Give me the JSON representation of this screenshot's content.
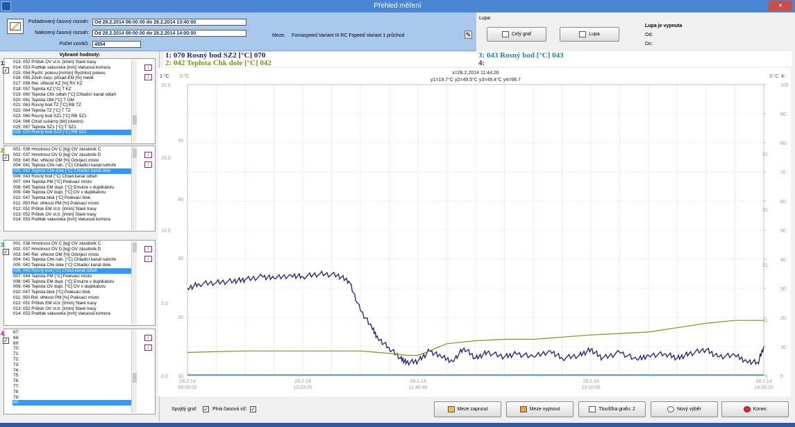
{
  "window": {
    "title": "Přehled měření",
    "close_label": "×"
  },
  "top": {
    "req_label": "Požadovaný časový rozsah:",
    "req_value": "Od 28.2.2014  08:00:00 do 28.2.2014  13:40:00",
    "found_label": "Nalezený časový rozsah:",
    "found_value": "Od 28.2.2014  08:00:00 do 28.2.2014  14:00:00",
    "count_label": "Počet vzorků:",
    "count_value": "4954",
    "limits_label": "Meze:",
    "limits_value": "Fomaspeed Variant III RC  Fspeed Variant 1 průchod"
  },
  "lupa": {
    "label": "Lupa:",
    "full_graph": "Celý graf",
    "zoom": "Lupa",
    "status": "Lupa je vypnuta",
    "od": "Od:",
    "do": "Do:"
  },
  "left": {
    "title": "Vybrané hodnoty:",
    "groups": [
      {
        "num": "1:",
        "items": [
          "013: 052 Průtok OV st.tr. [l/min]  Staré trasy",
          "014: 053 Podtlak vakuovka [mm]  Vakuová komora",
          "015: 054 Rychl. polevu [m/min]  Rychlost polevu",
          "016: 055 Zdvih čerp. přísad EM [%]  médii",
          "017: 056 Rel. vlhkost KZ [%]  RV KZ",
          "018: 057 Teplota KZ [°C]  T KZ",
          "019: 060 Teplota Chk odtah [°C]  Chladicí kanál odtah",
          "020: 061 Teplota OM [°C]  T OM",
          "021: 063 Rosný bod TZ [°C]  RB TZ",
          "022: 064 Teplota TZ [°C]  T TZ",
          "023: 065 Rosný bod SZ1 [°C]  RB SZ1",
          "024: 066 Chod sušárny [bit]  (vlastní)",
          "025: 067 Teplota SZ1 [°C]  T SZ1",
          "026: 070 Rosný bod SZ2 [°C]  RB SZ2"
        ],
        "selected": 13,
        "thumb": 0.78
      },
      {
        "num": "2:",
        "items": [
          "001: 036 Hmotnost OV C [kg]  OV zásobník C",
          "002: 037 Hmotnost OV D [kg]  OV zásobník D",
          "003: 040 Rel. vlhkost OM [%]  Odvíjecí místo",
          "004: 041 Teplota Chk nah. [°C]  Chladicí kanál nahoře",
          "005: 042 Teplota Chk dole [°C]  Chladicí kanál dole",
          "006: 043 Rosný bod [°C]  Chlad.kanál odtah",
          "007: 044 Teplota PM [°C]  Polévací místo",
          "008: 045 Teplota EM dupl. [°C]  Emulze v duplikátoru",
          "009: 046 Teplota OV dupl. [°C]  OV v duplikátoru",
          "010: 047 Teplota blok [°C]  Polévací blok",
          "011: 050 Rel. vlhkost PM [%]  Polévací místo",
          "012: 051 Průtok EM st.tr. [l/min]  Staré trasy",
          "013: 052 Průtok OV st.tr. [l/min]  Staré trasy",
          "014: 053 Podtlak vakuovka [mm]  Vakuová komora"
        ],
        "selected": 4,
        "thumb": 0.0
      },
      {
        "num": "3:",
        "items": [
          "001: 036 Hmotnost OV C [kg]  OV zásobník C",
          "002: 037 Hmotnost OV D [kg]  OV zásobník D",
          "003: 040 Rel. vlhkost OM [%]  Odvíjecí místo",
          "004: 041 Teplota Chk nah. [°C]  Chladicí kanál nahoře",
          "005: 042 Teplota Chk dole [°C]  Chladicí kanál dole",
          "006: 043 Rosný bod [°C]  Chlad.kanál odtah",
          "007: 044 Teplota PM [°C]  Polévací místo",
          "008: 045 Teplota EM dupl. [°C]  Emulze v duplikátoru",
          "009: 046 Teplota OV dupl. [°C]  OV v duplikátoru",
          "010: 047 Teplota blok [°C]  Polévací blok",
          "011: 050 Rel. vlhkost PM [%]  Polévací místo",
          "012: 051 Průtok EM st.tr. [l/min]  Staré trasy",
          "013: 052 Průtok OV st.tr. [l/min]  Staré trasy",
          "014: 053 Podtlak vakuovka [mm]  Vakuová komora"
        ],
        "selected": 5,
        "thumb": 0.0
      },
      {
        "num": "4:",
        "items": [
          "67:",
          "68:",
          "69:",
          "70:",
          "71:",
          "72:",
          "73:",
          "74:",
          "75:",
          "76:",
          "77:",
          "78:",
          "79:",
          "80:"
        ],
        "selected": 13,
        "thumb": 0.6
      }
    ]
  },
  "legend": {
    "l1": "1:  070 Rosný bod SZ2 [°C]  070",
    "l2": "2:  042 Teplota Chk dole [°C]  042",
    "l3": "3:  043 Rosný bod [°C]  043",
    "l4": "4:",
    "c1": "#1a1a7a",
    "c2": "#8a8a1a",
    "c3": "#1a8a8a",
    "c4": "#8a1a8a"
  },
  "chart_data": {
    "type": "line",
    "cursor_x": "x=28.2.2014  11:44:26",
    "cursor_y": "y1=19.7°C   y2=49.5°C   y3=49.4°C   y4=98.7",
    "axis_units": {
      "y1": "1:°C",
      "y2": "2:°C",
      "y3": "3:°C",
      "y4": "4:"
    },
    "x_ticks": [
      {
        "date": "28.2.14",
        "time": "09:00:00",
        "pos": 0.0
      },
      {
        "date": "28.2.14",
        "time": "10:23:20",
        "pos": 0.2
      },
      {
        "date": "28.2.14",
        "time": "11:46:40",
        "pos": 0.4
      },
      {
        "date": "28.2.14",
        "time": "13:10:00",
        "pos": 0.7
      },
      {
        "date": "28.2.14",
        "time": "14:33:20",
        "pos": 1.0
      }
    ],
    "y1_ticks": [
      "0.0",
      "5.0",
      "10.0",
      "15.0",
      "20.0"
    ],
    "y2_ticks": [
      "10",
      "20",
      "30",
      "40",
      "50"
    ],
    "y3_ticks": [
      "1",
      "11",
      "21",
      "31",
      "41"
    ],
    "y4_ticks": [
      "0",
      "10",
      "20",
      "30",
      "40",
      "50",
      "60",
      "70",
      "80",
      "90",
      "100"
    ],
    "y1_range": [
      0,
      20
    ],
    "series": [
      {
        "id": "1",
        "color": "#1a1a7a",
        "x": [
          0,
          0.02,
          0.05,
          0.08,
          0.1,
          0.13,
          0.15,
          0.18,
          0.2,
          0.23,
          0.26,
          0.28,
          0.3,
          0.32,
          0.33,
          0.35,
          0.37,
          0.38,
          0.4,
          0.42,
          0.44,
          0.46,
          0.48,
          0.5,
          0.52,
          0.55,
          0.57,
          0.6,
          0.63,
          0.65,
          0.68,
          0.7,
          0.72,
          0.75,
          0.78,
          0.8,
          0.83,
          0.85,
          0.87,
          0.9,
          0.92,
          0.95,
          0.97,
          0.99,
          1.0
        ],
        "y": [
          6.0,
          6.3,
          6.4,
          6.5,
          6.6,
          6.8,
          6.7,
          6.9,
          6.8,
          7.0,
          6.9,
          6.5,
          4.5,
          3.3,
          2.6,
          1.9,
          1.2,
          0.9,
          1.0,
          1.7,
          1.3,
          1.0,
          1.9,
          1.2,
          1.6,
          1.3,
          1.5,
          1.3,
          1.7,
          1.2,
          1.4,
          1.8,
          1.2,
          1.6,
          1.1,
          1.4,
          1.5,
          1.2,
          1.5,
          1.8,
          1.3,
          1.4,
          1.0,
          0.9,
          2.0
        ]
      },
      {
        "id": "2",
        "color": "#8a8a1a",
        "x": [
          0,
          0.1,
          0.2,
          0.26,
          0.3,
          0.33,
          0.36,
          0.38,
          0.4,
          0.42,
          0.45,
          0.5,
          0.55,
          0.6,
          0.7,
          0.8,
          0.85,
          0.9,
          0.95,
          1.0
        ],
        "y": [
          1.6,
          1.7,
          1.7,
          1.7,
          1.7,
          1.6,
          1.5,
          1.4,
          1.4,
          1.7,
          2.2,
          2.4,
          2.5,
          2.5,
          2.8,
          3.0,
          3.3,
          3.6,
          3.8,
          3.8
        ]
      },
      {
        "id": "3",
        "color": "#1a8a8a",
        "x": [
          0,
          1.0
        ],
        "y": [
          0.05,
          0.05
        ]
      }
    ]
  },
  "bottom": {
    "cont_label": "Spojitý graf:",
    "grid_label": "Plná časová síť:",
    "meze_on": "Meze zapnout",
    "meze_off": "Meze vypnout",
    "thickness": "Tloušťka grafu: 2",
    "new_sel": "Nový výběr",
    "end": "Konec"
  }
}
